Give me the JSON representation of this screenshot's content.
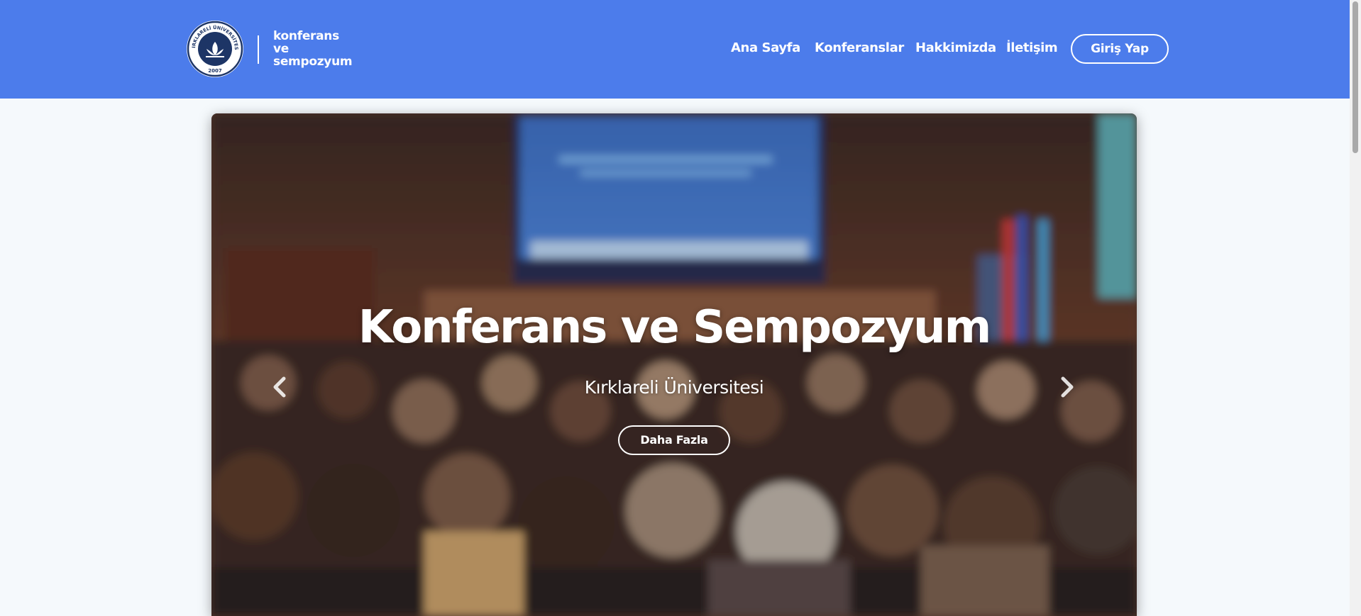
{
  "header": {
    "logo": {
      "seal_text": "KIRKLARELİ ÜNİVERSİTESİ",
      "seal_year": "2007",
      "lines": [
        "konferans",
        "ve",
        "sempozyum"
      ]
    },
    "nav": [
      "Ana Sayfa",
      "Konferanslar",
      "Hakkimizda",
      "İletişim"
    ],
    "login_label": "Giriş Yap",
    "background_color": "#4c7ceb"
  },
  "hero": {
    "title": "Konferans ve Sempozyum",
    "subtitle": "Kırklareli Üniversitesi",
    "button_label": "Daha Fazla",
    "prev_icon": "chevron-left-icon",
    "next_icon": "chevron-right-icon"
  }
}
